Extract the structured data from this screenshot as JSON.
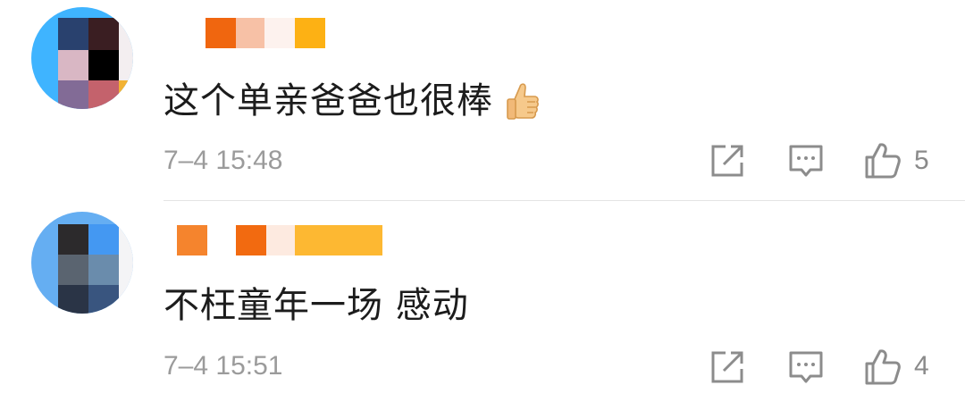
{
  "comments": [
    {
      "text": "这个单亲爸爸也很棒",
      "emoji_icon": "thumbs-up-emoji",
      "time": "7–4 15:48",
      "likes": "5",
      "avatar_colors": [
        "#29416e",
        "#3a1e22",
        "#d9b7c4",
        "#000000",
        "#826b96",
        "#c4626c",
        "#3fb4ff",
        "#f2b233"
      ],
      "name_colors": [
        "#f0660f",
        "#f7c1a6",
        "#fdf2ee",
        "#fdb114"
      ]
    },
    {
      "text": "不枉童年一场 感动",
      "time": "7–4 15:51",
      "likes": "4",
      "avatar_colors": [
        "#2c2a2c",
        "#4498f2",
        "#5a6470",
        "#6a8cac",
        "#2a3446",
        "#39557f",
        "#65aef2"
      ],
      "name_colors": [
        "#f5842d",
        "#f26a10",
        "#fdeae0",
        "#fdb832"
      ]
    }
  ],
  "icons": {
    "share": "share-icon",
    "comment": "comment-icon",
    "like": "thumbs-up-icon"
  },
  "colors": {
    "icon_gray": "#8c8c8c",
    "time_gray": "#9b9b9b",
    "divider": "#e4e4e4"
  }
}
